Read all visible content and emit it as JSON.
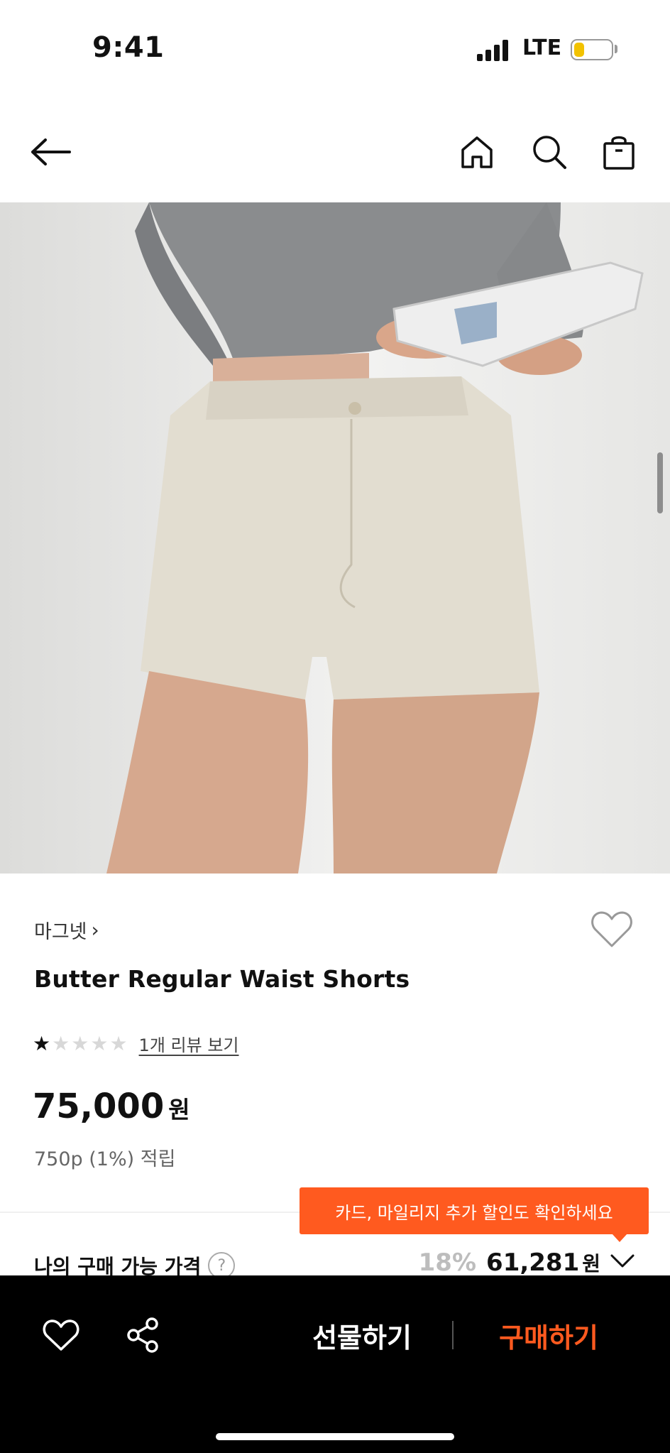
{
  "status_bar": {
    "time": "9:41",
    "network": "LTE",
    "battery_level": 0.28
  },
  "nav": {
    "back": "arrow-left-icon",
    "home": "home-icon",
    "search": "search-icon",
    "cart": "shopping-bag-icon"
  },
  "product": {
    "brand": "마그넷",
    "brand_chevron": "›",
    "name": "Butter Regular Waist Shorts",
    "rating": 1,
    "rating_max": 5,
    "review_link": "1개 리뷰 보기",
    "price": "75,000",
    "price_unit": "원",
    "points": "750p (1%) 적립"
  },
  "promo_tooltip": "카드, 마일리지 추가 할인도 확인하세요",
  "my_price": {
    "label": "나의 구매 가능 가격",
    "help": "?",
    "discount": "18%",
    "price": "61,281",
    "unit": "원"
  },
  "bottom_bar": {
    "gift_label": "선물하기",
    "buy_label": "구매하기"
  },
  "colors": {
    "accent": "#ff5a1f",
    "bar_bg": "#000000",
    "battery": "#f2c200"
  }
}
